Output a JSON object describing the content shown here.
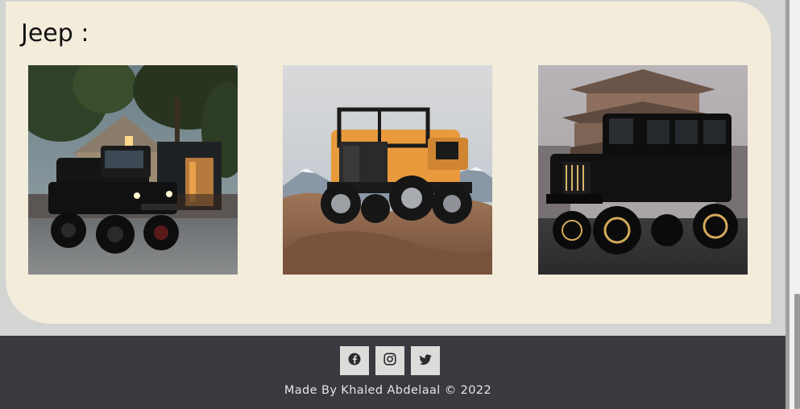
{
  "section": {
    "title": "Jeep :"
  },
  "gallery": {
    "images": [
      {
        "alt": "black six-wheel off-road vehicle parked in front of a house"
      },
      {
        "alt": "orange doorless jeep on a rocky outcrop"
      },
      {
        "alt": "black jeep in front of a pagoda"
      }
    ]
  },
  "footer": {
    "social_icons": [
      "facebook-icon",
      "instagram-icon",
      "twitter-icon"
    ],
    "credit": "Made By Khaled Abdelaal © 2022"
  },
  "colors": {
    "card_background": "#f3ecdb",
    "page_background": "#d3d5d2",
    "footer_background": "#3a393f",
    "social_button_background": "#dcdcda"
  }
}
